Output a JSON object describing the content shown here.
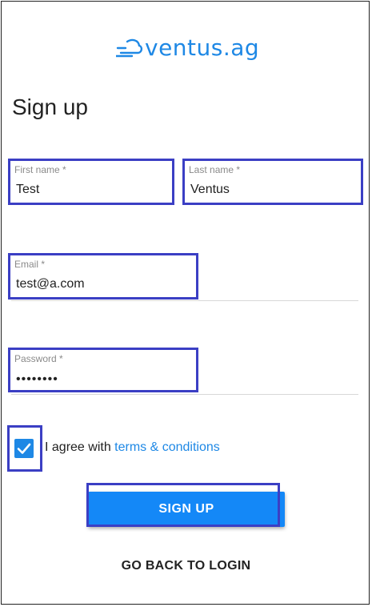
{
  "brand": {
    "name": "ventus.ag",
    "color": "#1e88e5"
  },
  "page_title": "Sign up",
  "fields": {
    "first_name": {
      "label": "First name *",
      "value": "Test"
    },
    "last_name": {
      "label": "Last name *",
      "value": "Ventus"
    },
    "email": {
      "label": "Email *",
      "value": "test@a.com"
    },
    "password": {
      "label": "Password *",
      "value": "••••••••"
    }
  },
  "agreement": {
    "checked": true,
    "prefix": "I agree with",
    "link_text": "terms & conditions"
  },
  "buttons": {
    "signup": "SIGN UP",
    "back_to_login": "GO BACK TO LOGIN"
  },
  "colors": {
    "primary": "#1488f7",
    "highlight": "#3b3fc4"
  }
}
